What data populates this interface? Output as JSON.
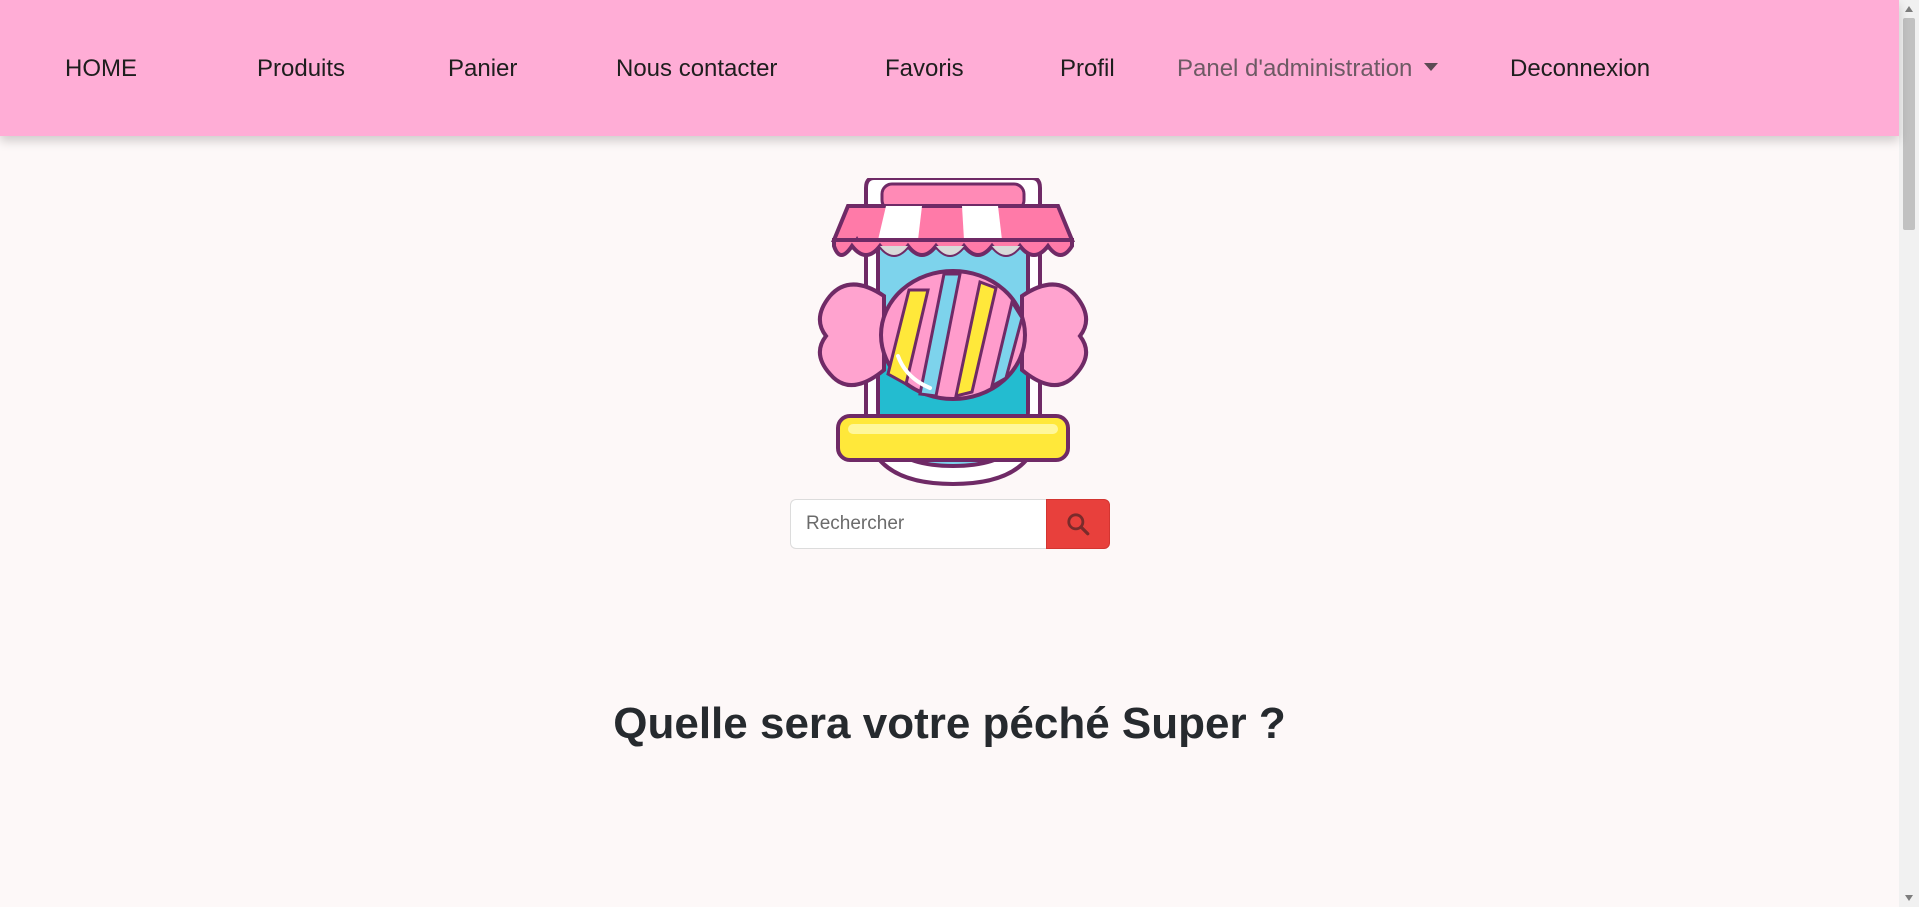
{
  "nav": {
    "items": [
      {
        "label": "HOME"
      },
      {
        "label": "Produits"
      },
      {
        "label": "Panier"
      },
      {
        "label": "Nous contacter"
      },
      {
        "label": "Favoris"
      },
      {
        "label": "Profil"
      },
      {
        "label": "Panel d'administration"
      },
      {
        "label": "Deconnexion"
      }
    ]
  },
  "logo": {
    "icon": "candy-shop-logo-icon"
  },
  "search": {
    "placeholder": "Rechercher",
    "value": "",
    "button_icon": "search-icon"
  },
  "main": {
    "headline": "Quelle sera votre péché Super ?"
  },
  "colors": {
    "navbar": "#ffadd6",
    "background": "#fdf8f8",
    "search_button": "#e8403c",
    "headline": "#262a2e"
  }
}
